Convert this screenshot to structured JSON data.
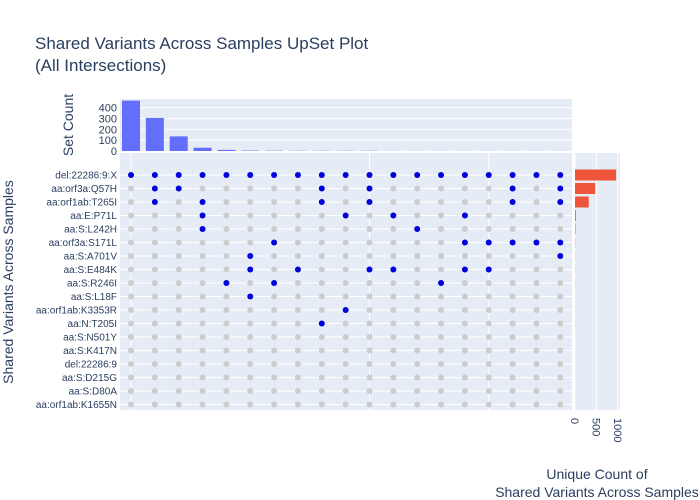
{
  "title_line1": "Shared Variants Across Samples UpSet Plot",
  "title_line2": "(All Intersections)",
  "colors": {
    "panel_bg": "#e5ecf6",
    "set_count_bar": "#636efa",
    "unique_count_bar": "#ef553b",
    "dot_active": "#0000dd",
    "dot_inactive": "#cccccc",
    "text": "#2a3f5f"
  },
  "chart_data": {
    "type": "bar",
    "title": "Shared Variants Across Samples UpSet Plot (All Intersections)",
    "top_bar": {
      "ylabel": "Set Count",
      "ylim": [
        0,
        480
      ],
      "ticks": [
        "0",
        "100",
        "200",
        "300",
        "400"
      ],
      "values": [
        465,
        305,
        135,
        30,
        10,
        4,
        3,
        2,
        2,
        2,
        2,
        1,
        1,
        1,
        1,
        1,
        1,
        1,
        1
      ]
    },
    "side_bar": {
      "xlabel_line1": "Unique Count of",
      "xlabel_line2": "Shared Variants Across Samples",
      "xlim": [
        0,
        1050
      ],
      "ticks": [
        "0",
        "500",
        "1000"
      ],
      "values": [
        960,
        470,
        320,
        20,
        10,
        5,
        3,
        3,
        3,
        2,
        2,
        2,
        1,
        1,
        1,
        1,
        1,
        1
      ]
    },
    "matrix": {
      "ylabel": "Shared Variants Across Samples",
      "rows": [
        "del:22286:9:X",
        "aa:orf3a:Q57H",
        "aa:orf1ab:T265I",
        "aa:E:P71L",
        "aa:S:L242H",
        "aa:orf3a:S171L",
        "aa:S:A701V",
        "aa:S:E484K",
        "aa:S:R246I",
        "aa:S:L18F",
        "aa:orf1ab:K3353R",
        "aa:N:T205I",
        "aa:S:N501Y",
        "aa:S:K417N",
        "del:22286:9",
        "aa:S:D215G",
        "aa:S:D80A",
        "aa:orf1ab:K1655N"
      ],
      "num_columns": 19,
      "active": [
        [
          0,
          0
        ],
        [
          1,
          0
        ],
        [
          1,
          1
        ],
        [
          1,
          2
        ],
        [
          2,
          0
        ],
        [
          2,
          1
        ],
        [
          3,
          0
        ],
        [
          3,
          2
        ],
        [
          3,
          3
        ],
        [
          3,
          4
        ],
        [
          4,
          0
        ],
        [
          4,
          8
        ],
        [
          5,
          0
        ],
        [
          5,
          6
        ],
        [
          5,
          7
        ],
        [
          5,
          9
        ],
        [
          6,
          0
        ],
        [
          6,
          5
        ],
        [
          6,
          8
        ],
        [
          7,
          0
        ],
        [
          7,
          7
        ],
        [
          8,
          0
        ],
        [
          8,
          1
        ],
        [
          8,
          2
        ],
        [
          8,
          11
        ],
        [
          9,
          0
        ],
        [
          9,
          3
        ],
        [
          9,
          10
        ],
        [
          10,
          0
        ],
        [
          10,
          1
        ],
        [
          10,
          2
        ],
        [
          10,
          7
        ],
        [
          11,
          0
        ],
        [
          11,
          3
        ],
        [
          11,
          7
        ],
        [
          12,
          0
        ],
        [
          12,
          4
        ],
        [
          13,
          0
        ],
        [
          13,
          8
        ],
        [
          14,
          0
        ],
        [
          14,
          5
        ],
        [
          14,
          3
        ],
        [
          14,
          7
        ],
        [
          15,
          0
        ],
        [
          15,
          5
        ],
        [
          15,
          7
        ],
        [
          16,
          0
        ],
        [
          16,
          1
        ],
        [
          16,
          2
        ],
        [
          16,
          5
        ],
        [
          17,
          0
        ],
        [
          17,
          5
        ],
        [
          18,
          0
        ],
        [
          18,
          1
        ],
        [
          18,
          2
        ],
        [
          18,
          5
        ],
        [
          18,
          6
        ]
      ]
    }
  }
}
